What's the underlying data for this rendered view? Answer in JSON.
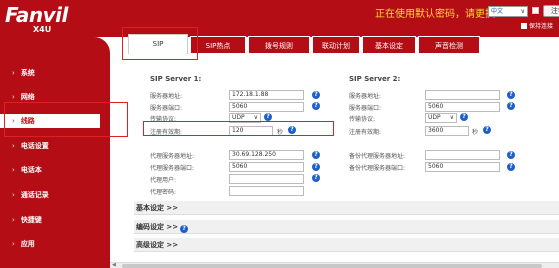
{
  "header": {
    "logo": "Fanvil",
    "model": "X4U",
    "warning": "正在使用默认密码，请更换",
    "language": "中文",
    "logout": "注销",
    "keep_login": "保持连接"
  },
  "tabs": [
    {
      "label": "SIP",
      "active": true
    },
    {
      "label": "SIP热点"
    },
    {
      "label": "拨号规则"
    },
    {
      "label": "联动计划"
    },
    {
      "label": "基本设定"
    },
    {
      "label": "声音检测"
    }
  ],
  "sidebar": [
    {
      "label": "系统"
    },
    {
      "label": "网络"
    },
    {
      "label": "线路",
      "active": true
    },
    {
      "label": "电话设置"
    },
    {
      "label": "电话本"
    },
    {
      "label": "通话记录"
    },
    {
      "label": "快捷键"
    },
    {
      "label": "应用"
    }
  ],
  "server1": {
    "title": "SIP Server 1:",
    "address_label": "服务器地址:",
    "address_value": "172.18.1.88",
    "port_label": "服务器端口:",
    "port_value": "5060",
    "transport_label": "传输协议:",
    "transport_value": "UDP",
    "expiry_label": "注册有效期:",
    "expiry_value": "120",
    "expiry_unit": "秒"
  },
  "server2": {
    "title": "SIP Server 2:",
    "address_label": "服务器地址:",
    "address_value": "",
    "port_label": "服务器端口:",
    "port_value": "5060",
    "transport_label": "传输协议:",
    "transport_value": "UDP",
    "expiry_label": "注册有效期:",
    "expiry_value": "3600",
    "expiry_unit": "秒"
  },
  "proxy": {
    "address_label": "代理服务器地址:",
    "address_value": "30.69.128.250",
    "port_label": "代理服务器端口:",
    "port_value": "5060",
    "user_label": "代理用户:",
    "user_value": "",
    "password_label": "代理密码:",
    "password_value": ""
  },
  "backup_proxy": {
    "address_label": "备份代理服务器地址:",
    "address_value": "",
    "port_label": "备份代理服务器端口:",
    "port_value": "5060"
  },
  "sections": {
    "basic": "基本设定 >>",
    "codec": "编码设定 >>",
    "advanced": "高级设定 >>"
  },
  "colors": {
    "brand_red": "#b40d15",
    "highlight_red": "#e02020",
    "help_blue": "#1e5fc9",
    "warning_yellow": "#ffd83a"
  }
}
